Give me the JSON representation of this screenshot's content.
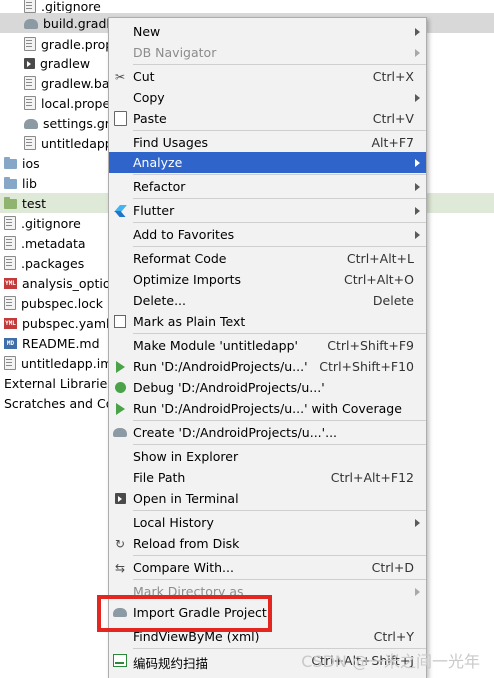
{
  "tree": {
    "rows": [
      {
        "label": ".gitignore",
        "icon": "file-icon"
      },
      {
        "label": "build.gradle",
        "icon": "gradle-icon"
      },
      {
        "label": "gradle.prop",
        "icon": "file-icon"
      },
      {
        "label": "gradlew",
        "icon": "terminal-icon"
      },
      {
        "label": "gradlew.ba",
        "icon": "file-icon"
      },
      {
        "label": "local.prope",
        "icon": "file-icon"
      },
      {
        "label": "settings.gra",
        "icon": "gradle-icon"
      },
      {
        "label": "untitledapp",
        "icon": "file-icon"
      },
      {
        "label": "ios",
        "icon": "folder-icon"
      },
      {
        "label": "lib",
        "icon": "folder-icon"
      },
      {
        "label": "test",
        "icon": "folder-icon"
      },
      {
        "label": ".gitignore",
        "icon": "file-icon"
      },
      {
        "label": ".metadata",
        "icon": "file-icon"
      },
      {
        "label": ".packages",
        "icon": "file-icon"
      },
      {
        "label": "analysis_option",
        "icon": "yml-icon"
      },
      {
        "label": "pubspec.lock",
        "icon": "file-icon"
      },
      {
        "label": "pubspec.yaml",
        "icon": "yml-icon"
      },
      {
        "label": "README.md",
        "icon": "md-icon"
      },
      {
        "label": "untitledapp.im",
        "icon": "file-icon"
      },
      {
        "label": "External Libraries",
        "icon": "library-icon"
      },
      {
        "label": "Scratches and Co",
        "icon": "scratches-icon"
      }
    ],
    "icon_text": {
      "yml": "YML",
      "md": "MD"
    }
  },
  "menu": {
    "items": [
      {
        "label": "New",
        "shortcut": "",
        "submenu": true,
        "icon": ""
      },
      {
        "label": "DB Navigator",
        "shortcut": "",
        "submenu": true,
        "icon": "",
        "disabled": true
      },
      {
        "label": "Cut",
        "shortcut": "Ctrl+X",
        "submenu": false,
        "icon": "scissors-icon"
      },
      {
        "label": "Copy",
        "shortcut": "",
        "submenu": true,
        "icon": ""
      },
      {
        "label": "Paste",
        "shortcut": "Ctrl+V",
        "submenu": false,
        "icon": "paste-icon"
      },
      {
        "label": "Find Usages",
        "shortcut": "Alt+F7",
        "submenu": false,
        "icon": ""
      },
      {
        "label": "Analyze",
        "shortcut": "",
        "submenu": true,
        "icon": "",
        "highlight": true
      },
      {
        "label": "Refactor",
        "shortcut": "",
        "submenu": true,
        "icon": ""
      },
      {
        "label": "Flutter",
        "shortcut": "",
        "submenu": true,
        "icon": "flutter-icon"
      },
      {
        "label": "Add to Favorites",
        "shortcut": "",
        "submenu": true,
        "icon": ""
      },
      {
        "label": "Reformat Code",
        "shortcut": "Ctrl+Alt+L",
        "submenu": false,
        "icon": ""
      },
      {
        "label": "Optimize Imports",
        "shortcut": "Ctrl+Alt+O",
        "submenu": false,
        "icon": ""
      },
      {
        "label": "Delete...",
        "shortcut": "Delete",
        "submenu": false,
        "icon": ""
      },
      {
        "label": "Mark as Plain Text",
        "shortcut": "",
        "submenu": false,
        "icon": "mark-icon"
      },
      {
        "label": "Make Module 'untitledapp'",
        "shortcut": "Ctrl+Shift+F9",
        "submenu": false,
        "icon": ""
      },
      {
        "label": "Run 'D:/AndroidProjects/u...'",
        "shortcut": "Ctrl+Shift+F10",
        "submenu": false,
        "icon": "run-icon"
      },
      {
        "label": "Debug 'D:/AndroidProjects/u...'",
        "shortcut": "",
        "submenu": false,
        "icon": "debug-icon"
      },
      {
        "label": "Run 'D:/AndroidProjects/u...' with Coverage",
        "shortcut": "",
        "submenu": false,
        "icon": "coverage-icon"
      },
      {
        "label": "Create 'D:/AndroidProjects/u...'...",
        "shortcut": "",
        "submenu": false,
        "icon": "gradle-icon"
      },
      {
        "label": "Show in Explorer",
        "shortcut": "",
        "submenu": false,
        "icon": ""
      },
      {
        "label": "File Path",
        "shortcut": "Ctrl+Alt+F12",
        "submenu": false,
        "icon": ""
      },
      {
        "label": "Open in Terminal",
        "shortcut": "",
        "submenu": false,
        "icon": "terminal-icon"
      },
      {
        "label": "Local History",
        "shortcut": "",
        "submenu": true,
        "icon": ""
      },
      {
        "label": "Reload from Disk",
        "shortcut": "",
        "submenu": false,
        "icon": "reload-icon"
      },
      {
        "label": "Compare With...",
        "shortcut": "Ctrl+D",
        "submenu": false,
        "icon": "compare-icon"
      },
      {
        "label": "Mark Directory as",
        "shortcut": "",
        "submenu": true,
        "icon": "",
        "disabled": true
      },
      {
        "label": "Import Gradle Project",
        "shortcut": "",
        "submenu": false,
        "icon": "gradle-icon"
      },
      {
        "label": "FindViewByMe (xml)",
        "shortcut": "Ctrl+Y",
        "submenu": false,
        "icon": ""
      },
      {
        "label": "编码规约扫描",
        "shortcut": "Ctrl+Alt+Shift+J",
        "submenu": false,
        "icon": "coding-scan-icon"
      }
    ],
    "icon_glyphs": {
      "scissors": "✂",
      "reload": "↻",
      "compare": "⇆"
    }
  },
  "watermark": "CSDN @一米之间一光年",
  "colors": {
    "highlight": "#2f65ca",
    "annotation": "#e3261f"
  }
}
